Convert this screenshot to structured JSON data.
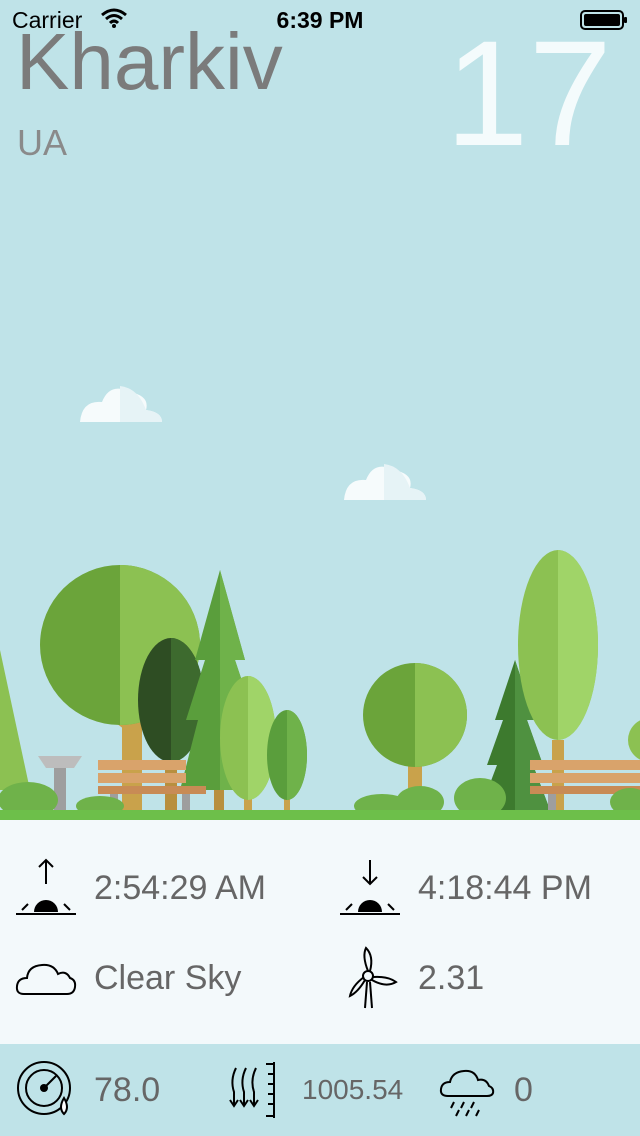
{
  "status_bar": {
    "carrier": "Carrier",
    "time": "6:39 PM"
  },
  "location": {
    "city": "Kharkiv",
    "country": "UA"
  },
  "temperature": "17",
  "details": {
    "sunrise": "2:54:29 AM",
    "sunset": "4:18:44 PM",
    "condition": "Clear Sky",
    "wind_speed": "2.31"
  },
  "bottom": {
    "humidity": "78.0",
    "pressure": "1005.54",
    "precipitation": "0"
  },
  "colors": {
    "sky": "#bfe3e8",
    "panel": "#f3f9fb",
    "grass": "#6dbf4a"
  }
}
